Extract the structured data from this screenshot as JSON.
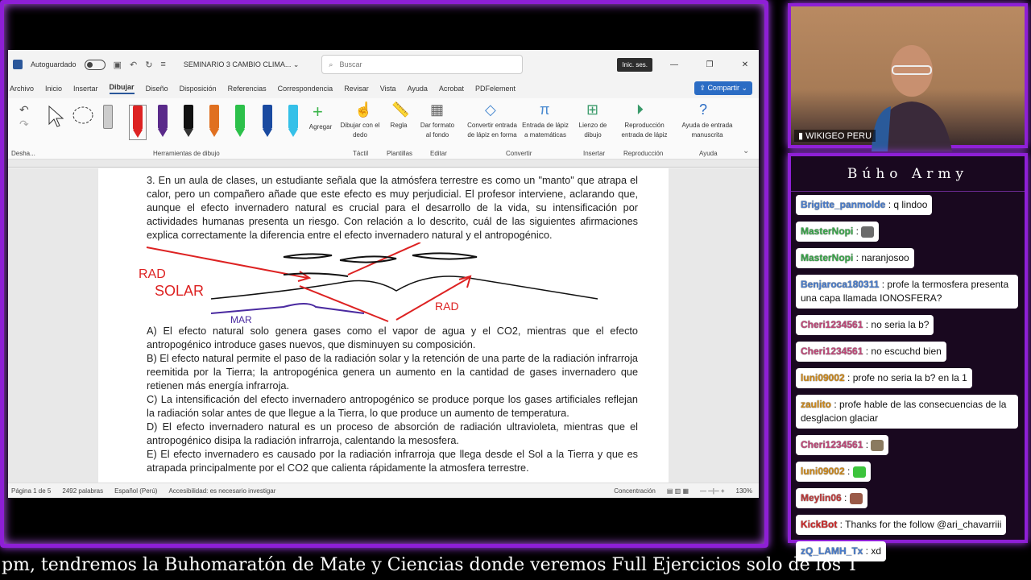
{
  "word": {
    "autosave_label": "Autoguardado",
    "doc_title": "SEMINARIO 3 CAMBIO CLIMA...",
    "search_placeholder": "Buscar",
    "signin": "Inic. ses.",
    "menu": [
      "Archivo",
      "Inicio",
      "Insertar",
      "Dibujar",
      "Diseño",
      "Disposición",
      "Referencias",
      "Correspondencia",
      "Revisar",
      "Vista",
      "Ayuda",
      "Acrobat",
      "PDFelement"
    ],
    "share": "Compartir",
    "ribbon": {
      "undo_label": "Desha...",
      "add_label": "Agregar",
      "tools_group": "Herramientas de dibujo",
      "draw_finger": "Dibujar con el dedo",
      "tactil": "Táctil",
      "ruler": "Regla",
      "templates": "Plantillas",
      "bg_format": "Dar formato al fondo",
      "edit": "Editar",
      "ink_shape": "Convertir entrada de lápiz en forma",
      "ink_math": "Entrada de lápiz a matemáticas",
      "convert": "Convertir",
      "canvas": "Lienzo de dibujo",
      "insert": "Insertar",
      "replay": "Reproducción entrada de lápiz",
      "playback": "Reproducción",
      "ink_help": "Ayuda de entrada manuscrita",
      "help": "Ayuda"
    },
    "question": "3. En un aula de clases, un estudiante señala que la atmósfera terrestre es como un \"manto\" que atrapa el calor, pero un compañero añade que este efecto es muy perjudicial. El profesor interviene, aclarando que, aunque el efecto invernadero natural es crucial para el desarrollo de la vida, su intensificación por actividades humanas presenta un riesgo. Con relación a lo descrito, cuál de las siguientes afirmaciones explica correctamente la diferencia entre el efecto invernadero natural y el antropogénico.",
    "sketch": {
      "rad_solar_1": "RAD",
      "rad_solar_2": "SOLAR",
      "mar": "MAR",
      "rad_ir": "RAD"
    },
    "options": [
      "A) El efecto natural solo genera gases como el vapor de agua y el CO2, mientras que el efecto antropogénico introduce gases nuevos, que disminuyen su composición.",
      "B) El efecto natural permite el paso de la radiación solar y la retención de una parte de la radiación infrarroja reemitida por la Tierra; la antropogénica genera un aumento en la cantidad de gases invernadero que retienen más energía infrarroja.",
      "C) La intensificación del efecto invernadero antropogénico se produce porque los gases artificiales reflejan la radiación solar antes de que llegue a la Tierra, lo que produce un aumento de temperatura.",
      "D) El efecto invernadero natural es un proceso de absorción de radiación ultravioleta, mientras que el antropogénico disipa la radiación infrarroja, calentando la mesosfera.",
      "E) El efecto invernadero es causado por la radiación infrarroja que llega desde el Sol a la Tierra y que es atrapada principalmente por el CO2 que calienta rápidamente la atmosfera terrestre."
    ],
    "status": {
      "page": "Página 1 de 5",
      "words": "2492 palabras",
      "lang": "Español (Perú)",
      "access": "Accesibilidad: es necesario investigar",
      "focus": "Concentración",
      "zoom": "130%"
    }
  },
  "cam": {
    "label": "WIKIGEO PERU"
  },
  "chat": {
    "title": "Búho Army",
    "messages": [
      {
        "user": "Brigitte_panmolde",
        "color": "#4a7ecf",
        "text": ": q lindoo"
      },
      {
        "user": "MasterNopi",
        "color": "#3aa84a",
        "text": ":",
        "emote": "#6b6b6b"
      },
      {
        "user": "MasterNopi",
        "color": "#3aa84a",
        "text": ": naranjosoo"
      },
      {
        "user": "Benjaroca180311",
        "color": "#4a7ecf",
        "text": ": profe la termosfera presenta una capa llamada IONOSFERA?"
      },
      {
        "user": "Cheri1234561",
        "color": "#c2487a",
        "text": ": no seria la b?"
      },
      {
        "user": "Cheri1234561",
        "color": "#c2487a",
        "text": ": no escuchd bien"
      },
      {
        "user": "luni09002",
        "color": "#d08a1a",
        "text": ": profe no seria la b? en la 1"
      },
      {
        "user": "zaulito",
        "color": "#d08a1a",
        "text": ": profe hable de las consecuencias de la desglacion glaciar"
      },
      {
        "user": "Cheri1234561",
        "color": "#c2487a",
        "text": ":",
        "emote": "#8a7a60"
      },
      {
        "user": "luni09002",
        "color": "#d08a1a",
        "text": ":",
        "emote": "#3cc43c"
      },
      {
        "user": "Meylin06",
        "color": "#c23a3a",
        "text": ":",
        "emote": "#9a5a48"
      },
      {
        "user": "KickBot",
        "color": "#d02a2a",
        "text": ": Thanks for the follow @ari_chavarriii"
      },
      {
        "user": "zQ_LAMH_Tx",
        "color": "#4a7ecf",
        "text": ": xd"
      }
    ]
  },
  "ticker": "pm, tendremos la Buhomaratón de Mate y Ciencias donde veremos Full Ejercicios solo de los T"
}
